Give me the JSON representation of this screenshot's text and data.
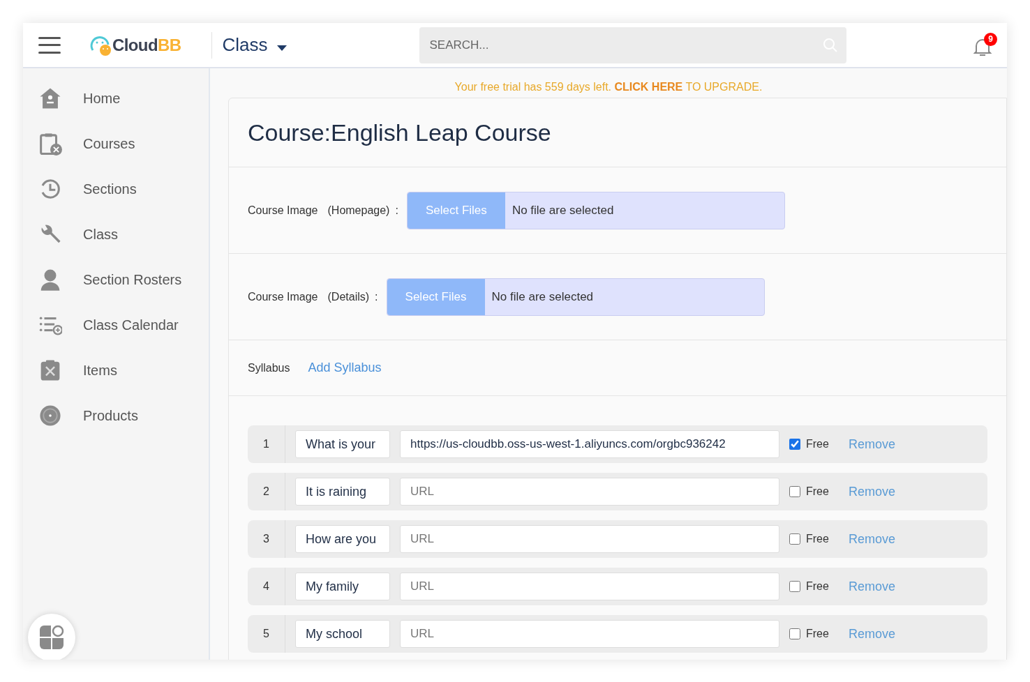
{
  "header": {
    "logo": {
      "part1": "Cloud",
      "part2": "BB"
    },
    "context": "Class",
    "search": {
      "placeholder": "SEARCH..."
    },
    "notifications": {
      "count": "9"
    }
  },
  "sidebar": {
    "items": [
      {
        "kind": "home",
        "label": "Home"
      },
      {
        "kind": "courses",
        "label": "Courses"
      },
      {
        "kind": "sections",
        "label": "Sections"
      },
      {
        "kind": "class",
        "label": "Class"
      },
      {
        "kind": "rosters",
        "label": "Section Rosters"
      },
      {
        "kind": "calendar",
        "label": "Class Calendar"
      },
      {
        "kind": "items",
        "label": "Items"
      },
      {
        "kind": "products",
        "label": "Products"
      }
    ]
  },
  "trial_banner": {
    "text": "Your free trial has 559 days left.",
    "link": "CLICK HERE",
    "suffix": "TO UPGRADE."
  },
  "course": {
    "title": "Course:English Leap Course",
    "uploads": [
      {
        "label": "Course Image",
        "qualifier": "(Homepage)",
        "colon": ":",
        "button": "Select Files",
        "status": "No file are selected"
      },
      {
        "label": "Course Image",
        "qualifier": "(Details)",
        "colon": ":",
        "button": "Select Files",
        "status": "No file are selected"
      }
    ],
    "syllabus": {
      "label": "Syllabus",
      "add_link": "Add Syllabus"
    },
    "lessons": [
      {
        "number": "1",
        "title": "What is your",
        "url": "https://us-cloudbb.oss-us-west-1.aliyuncs.com/orgbc936242",
        "free_label": "Free",
        "free": true,
        "remove": "Remove"
      },
      {
        "number": "2",
        "title": "It is raining",
        "url_placeholder": "URL",
        "free_label": "Free",
        "free": false,
        "remove": "Remove"
      },
      {
        "number": "3",
        "title": "How are you",
        "url_placeholder": "URL",
        "free_label": "Free",
        "free": false,
        "remove": "Remove"
      },
      {
        "number": "4",
        "title": "My family",
        "url_placeholder": "URL",
        "free_label": "Free",
        "free": false,
        "remove": "Remove"
      },
      {
        "number": "5",
        "title": "My school",
        "url_placeholder": "URL",
        "free_label": "Free",
        "free": false,
        "remove": "Remove"
      }
    ]
  }
}
